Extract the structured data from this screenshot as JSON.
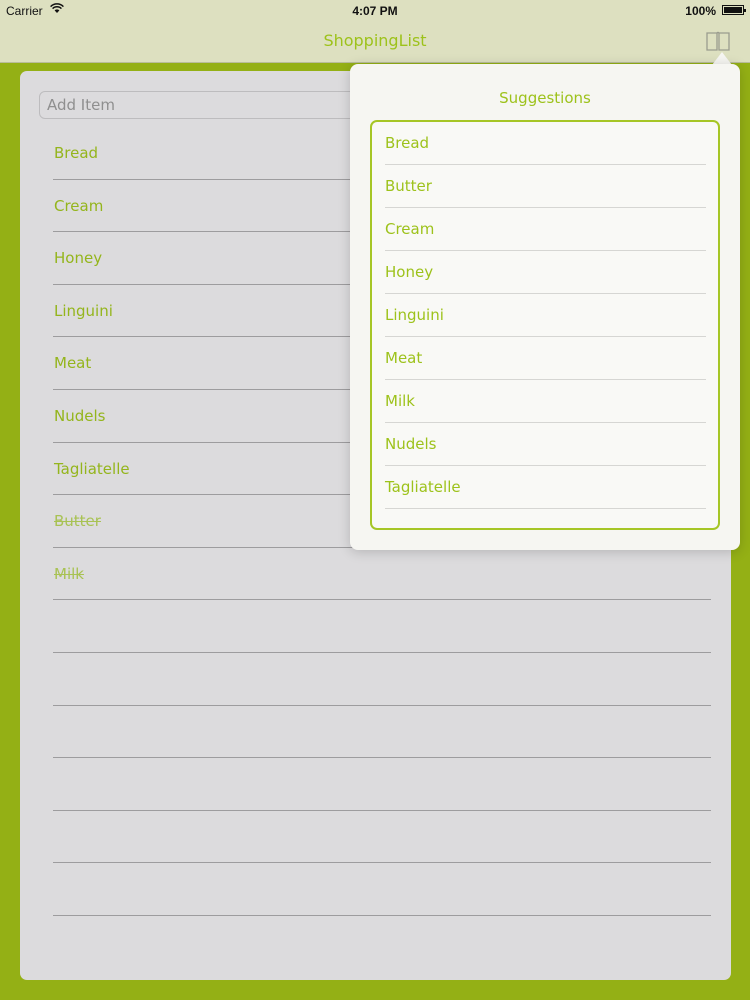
{
  "status_bar": {
    "carrier": "Carrier",
    "time": "4:07 PM",
    "battery": "100%"
  },
  "nav": {
    "title": "ShoppingList"
  },
  "add_item": {
    "placeholder": "Add Item"
  },
  "list": {
    "active": [
      "Bread",
      "Cream",
      "Honey",
      "Linguini",
      "Meat",
      "Nudels",
      "Tagliatelle"
    ],
    "done": [
      "Butter",
      "Milk"
    ]
  },
  "suggestions": {
    "title": "Suggestions",
    "items": [
      "Bread",
      "Butter",
      "Cream",
      "Honey",
      "Linguini",
      "Meat",
      "Milk",
      "Nudels",
      "Tagliatelle"
    ]
  },
  "colors": {
    "accent": "#9dc21b",
    "background": "#94b015",
    "paper": "#dcdbdd",
    "bar": "#dde0c0"
  }
}
